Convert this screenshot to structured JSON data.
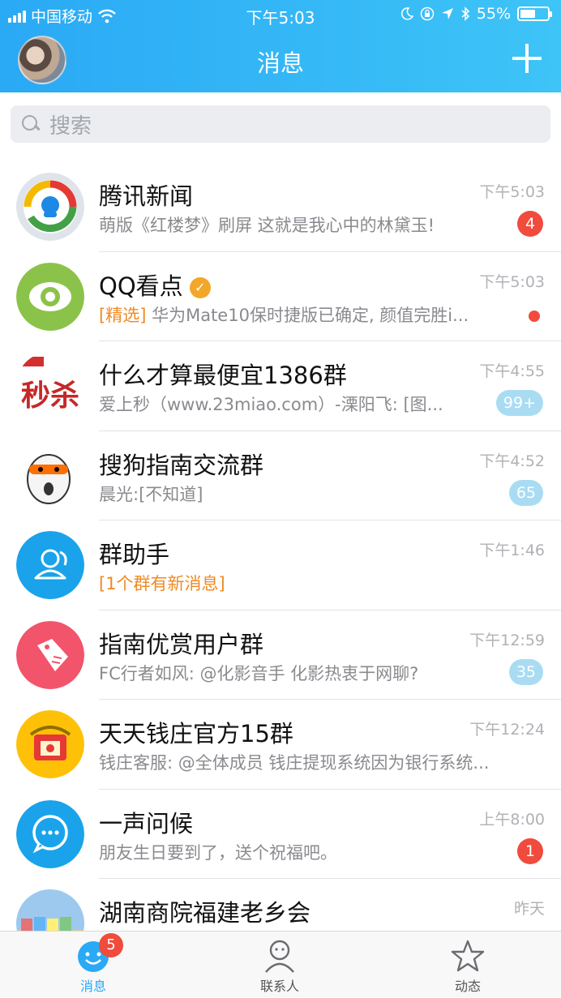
{
  "status_bar": {
    "carrier": "中国移动",
    "time": "下午5:03",
    "battery": "55%",
    "battery_level": 0.55
  },
  "header": {
    "title": "消息"
  },
  "search": {
    "placeholder": "搜索"
  },
  "conversations": [
    {
      "name": "腾讯新闻",
      "preview": "萌版《红楼梦》刷屏 这就是我心中的林黛玉!",
      "preview_tag": "",
      "time": "下午5:03",
      "badge": "4",
      "badge_style": "red",
      "avatar_icon": "tencent-news-icon",
      "verified": false
    },
    {
      "name": "QQ看点",
      "preview": "华为Mate10保时捷版已确定, 颜值完胜i...",
      "preview_tag": "[精选]",
      "time": "下午5:03",
      "badge": "",
      "badge_style": "dot",
      "avatar_icon": "qq-kandian-eye-icon",
      "verified": true
    },
    {
      "name": "什么才算最便宜1386群",
      "preview": "爱上秒（www.23miao.com）-溧阳飞: [图...",
      "preview_tag": "",
      "time": "下午4:55",
      "badge": "99+",
      "badge_style": "muted",
      "avatar_icon": "miaosha-logo-icon",
      "verified": false
    },
    {
      "name": "搜狗指南交流群",
      "preview": "晨光:[不知道]",
      "preview_tag": "",
      "time": "下午4:52",
      "badge": "65",
      "badge_style": "muted",
      "avatar_icon": "sogou-dog-icon",
      "verified": false
    },
    {
      "name": "群助手",
      "preview": "",
      "preview_tag": "[1个群有新消息]",
      "time": "下午1:46",
      "badge": "",
      "badge_style": "none",
      "avatar_icon": "group-helper-icon",
      "verified": false
    },
    {
      "name": "指南优赏用户群",
      "preview": "FC行者如风: @化影音手 化影热衷于网聊?",
      "preview_tag": "",
      "time": "下午12:59",
      "badge": "35",
      "badge_style": "muted",
      "avatar_icon": "price-tag-icon",
      "verified": false
    },
    {
      "name": "天天钱庄官方15群",
      "preview": "钱庄客服: @全体成员 钱庄提现系统因为银行系统...",
      "preview_tag": "",
      "time": "下午12:24",
      "badge": "",
      "badge_style": "none",
      "avatar_icon": "money-house-icon",
      "verified": false
    },
    {
      "name": "一声问候",
      "preview": "朋友生日要到了，送个祝福吧。",
      "preview_tag": "",
      "time": "上午8:00",
      "badge": "1",
      "badge_style": "red",
      "avatar_icon": "chat-bubble-icon",
      "verified": false
    },
    {
      "name": "湖南商院福建老乡会",
      "preview": "",
      "preview_tag": "",
      "time": "昨天",
      "badge": "",
      "badge_style": "none",
      "avatar_icon": "beach-huts-photo-icon",
      "verified": false
    }
  ],
  "tabbar": {
    "tabs": [
      {
        "label": "消息",
        "icon": "message-face-icon",
        "badge": "5",
        "active": true
      },
      {
        "label": "联系人",
        "icon": "contacts-person-icon",
        "badge": "",
        "active": false
      },
      {
        "label": "动态",
        "icon": "star-icon",
        "badge": "",
        "active": false
      }
    ]
  },
  "colors": {
    "accent": "#2aa9f5",
    "badge_red": "#f04b3c",
    "badge_muted": "#a9dcf2",
    "highlight": "#f08a24"
  }
}
